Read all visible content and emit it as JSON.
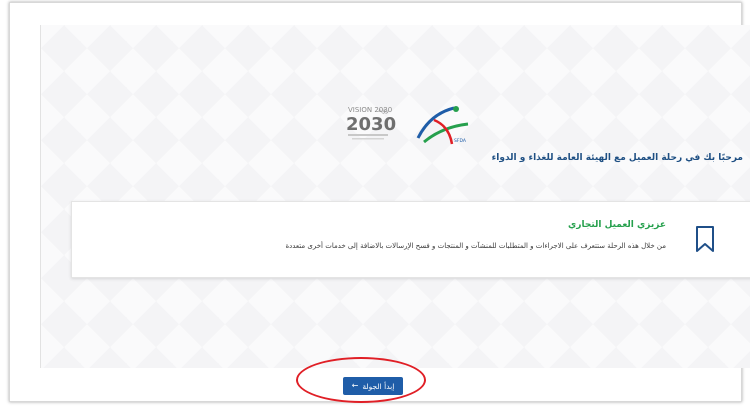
{
  "header": {
    "vision_logo_text": "VISION 2030",
    "vision_logo_arabic": "رؤية",
    "sfda_logo_text": "SFDA"
  },
  "welcome": {
    "text": "مرحبًا بك في رحلة العميل مع الهيئة العامة للغذاء و الدواء"
  },
  "card": {
    "title": "عزيزي العميل التجاري",
    "description": "من خلال هذه الرحلة ستتعرف على الاجراءات و المتطلبات للمنشآت و المنتجات و فسح الإرسالات بالاضافة إلى خدمات أخرى متعددة",
    "icon": "bookmark-icon"
  },
  "start_button": {
    "label": "إبدأ الجولة",
    "icon": "arrow-left-icon"
  },
  "colors": {
    "accent": "#1f5da8",
    "title_green": "#26a04d",
    "welcome_blue": "#1e4f83",
    "highlight_red": "#e01f26"
  }
}
